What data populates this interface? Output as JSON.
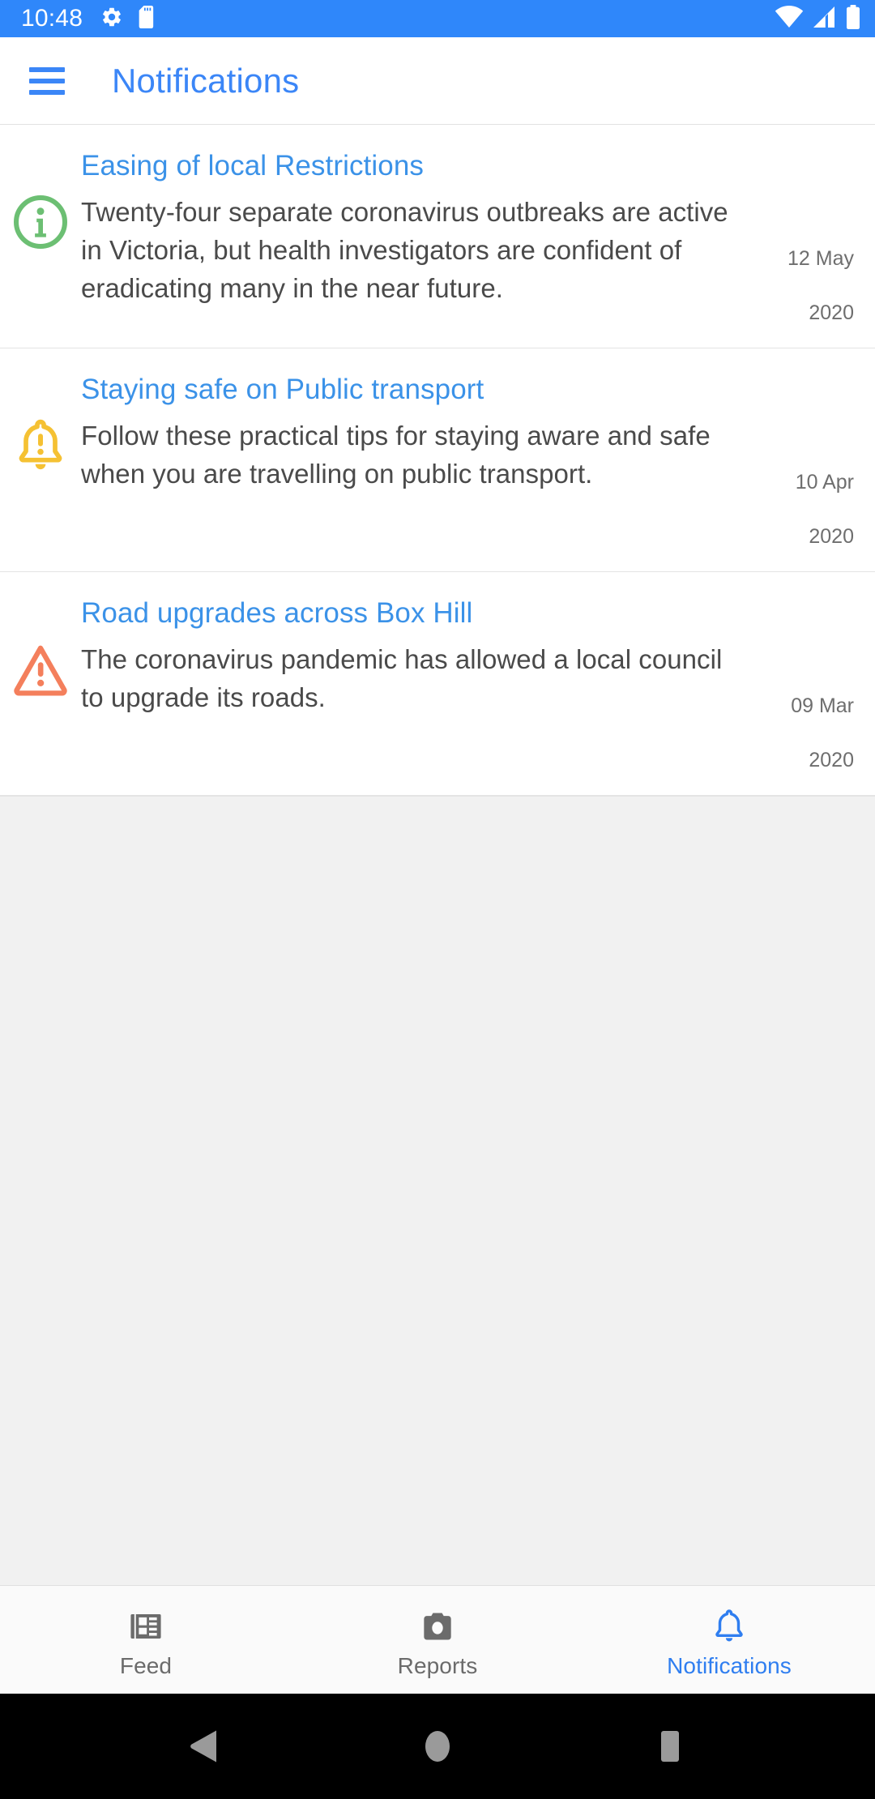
{
  "status_bar": {
    "time": "10:48",
    "left_icons": [
      "gear-icon",
      "sd-card-icon"
    ],
    "right_icons": [
      "wifi-icon",
      "cell-signal-icon",
      "battery-icon"
    ],
    "background_color": "#2f87fa"
  },
  "app_bar": {
    "menu_icon": "hamburger-menu-icon",
    "title": "Notifications",
    "title_color": "#3b86f7"
  },
  "notifications": [
    {
      "icon": "info-circle-icon",
      "icon_color": "#6cbf73",
      "title": "Easing of local Restrictions",
      "description": "Twenty-four separate coronavirus outbreaks are active in Victoria, but health investigators are confident of eradicating many in the near future.",
      "date_day": "12 May",
      "date_year": "2020"
    },
    {
      "icon": "bell-alert-icon",
      "icon_color": "#f5c133",
      "title": "Staying safe on Public transport",
      "description": "Follow these practical tips for staying aware and safe when you are travelling on public transport.",
      "date_day": "10 Apr",
      "date_year": "2020"
    },
    {
      "icon": "warning-triangle-icon",
      "icon_color": "#f47f5c",
      "title": "Road upgrades across Box Hill",
      "description": "The coronavirus pandemic has allowed a local council to upgrade its roads.",
      "date_day": "09 Mar",
      "date_year": "2020"
    }
  ],
  "bottom_nav": {
    "active_color": "#2f7ef0",
    "inactive_color": "#6b6b6b",
    "items": [
      {
        "icon": "newspaper-icon",
        "label": "Feed",
        "active": false
      },
      {
        "icon": "camera-icon",
        "label": "Reports",
        "active": false
      },
      {
        "icon": "bell-icon",
        "label": "Notifications",
        "active": true
      }
    ]
  },
  "system_nav": {
    "buttons": [
      "back-triangle-icon",
      "home-circle-icon",
      "recents-square-icon"
    ],
    "background_color": "#000000",
    "icon_color": "#9a9a9a"
  }
}
